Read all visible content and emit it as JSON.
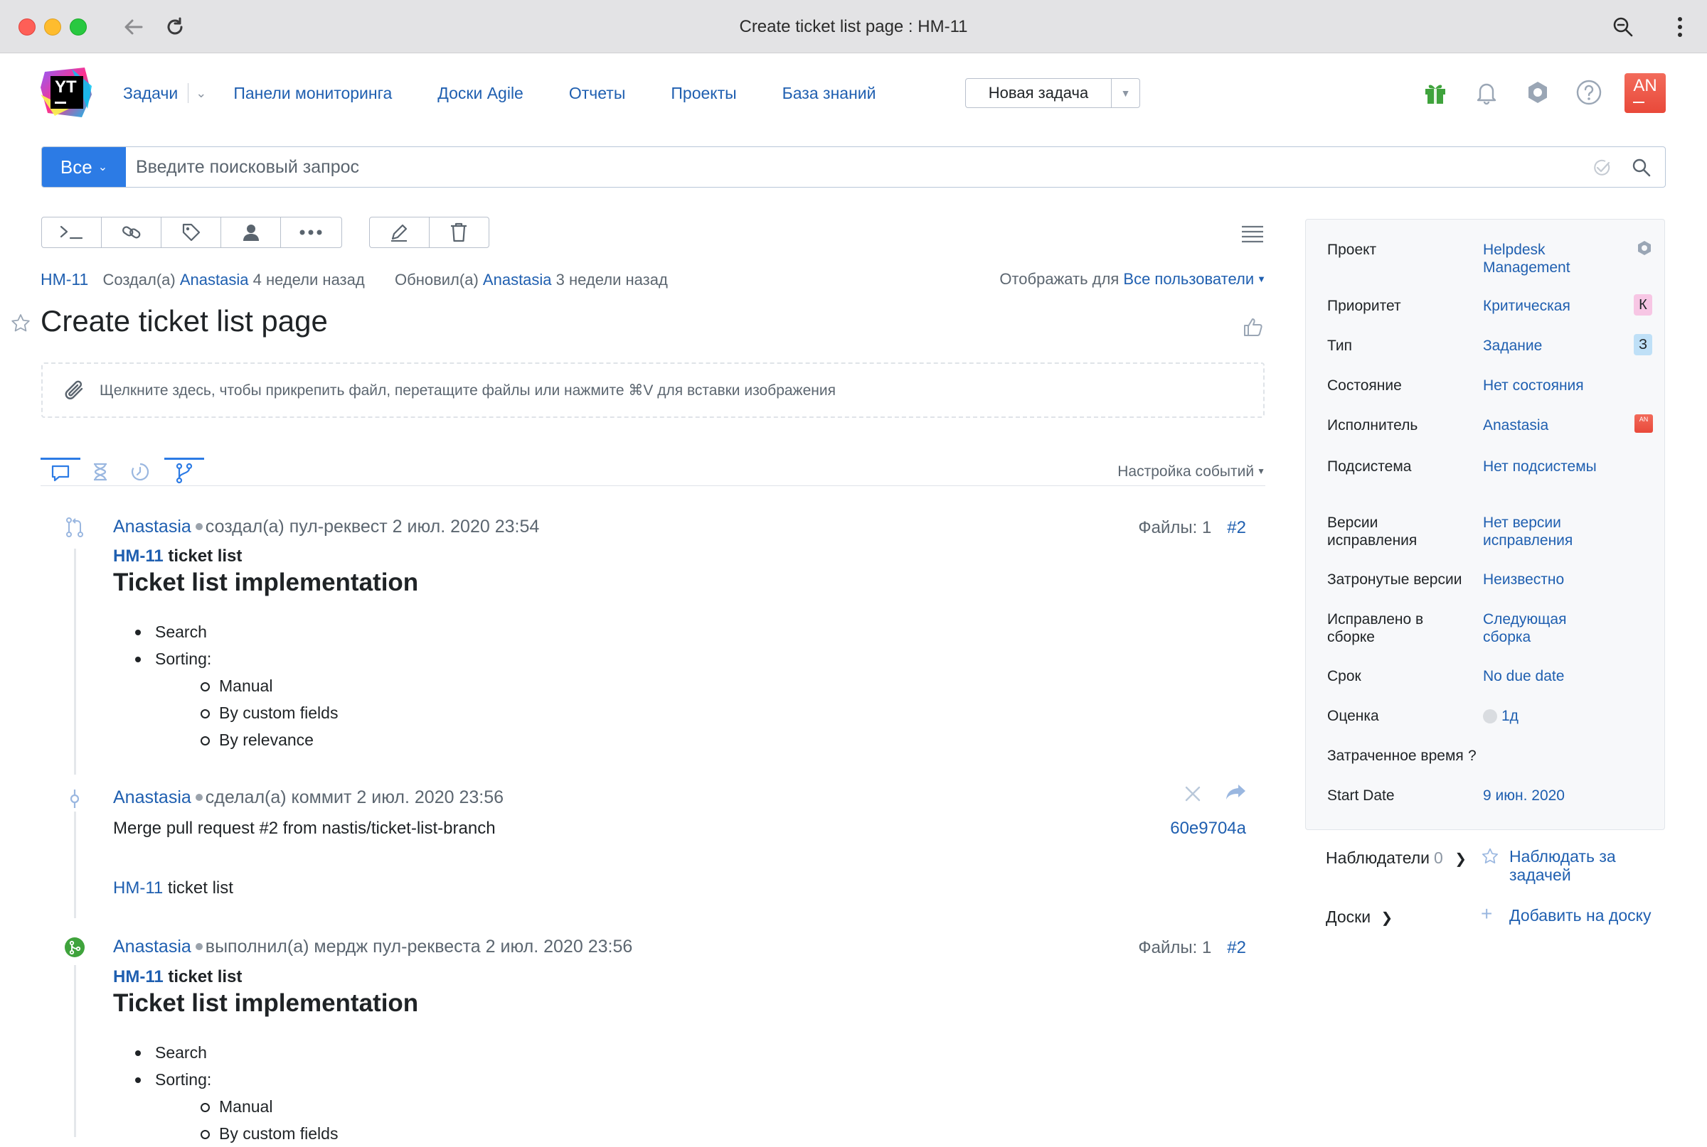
{
  "window": {
    "title": "Create ticket list page : HM-11"
  },
  "logo": {
    "text": "YT"
  },
  "nav": {
    "issues": "Задачи",
    "dashboards": "Панели мониторинга",
    "agile": "Доски Agile",
    "reports": "Отчеты",
    "projects": "Проекты",
    "kb": "База знаний",
    "new_issue": "Новая задача"
  },
  "user": {
    "initials": "AN"
  },
  "search": {
    "context": "Все",
    "placeholder": "Введите поисковый запрос"
  },
  "issue": {
    "id": "HM-11",
    "created_label": "Создал(а)",
    "created_by": "Anastasia",
    "created_ago": "4 недели назад",
    "updated_label": "Обновил(а)",
    "updated_by": "Anastasia",
    "updated_ago": "3 недели назад",
    "visible_label": "Отображать для",
    "visible_value": "Все пользователи",
    "summary": "Create ticket list page",
    "attach_hint": "Щелкните здесь, чтобы прикрепить файл, перетащите файлы или нажмите ⌘V для вставки изображения"
  },
  "activity": {
    "events_settings": "Настройка событий"
  },
  "feed": [
    {
      "author": "Anastasia",
      "action": "создал(а) пул-реквест 2 июл. 2020 23:54",
      "files": "Файлы: 1",
      "hash": "#2",
      "title_id": "HM-11",
      "title_text": "ticket list",
      "heading": "Ticket list implementation",
      "bullets": [
        "Search",
        "Sorting:",
        "Manual",
        "By custom fields",
        "By relevance"
      ]
    },
    {
      "author": "Anastasia",
      "action": "сделал(а) коммит 2 июл. 2020 23:56",
      "message": "Merge pull request #2 from nastis/ticket-list-branch",
      "commit": "60e9704a",
      "ref_id": "HM-11",
      "ref_text": "ticket list"
    },
    {
      "author": "Anastasia",
      "action": "выполнил(а) мердж пул-реквеста 2 июл. 2020 23:56",
      "files": "Файлы: 1",
      "hash": "#2",
      "title_id": "HM-11",
      "title_text": "ticket list",
      "heading": "Ticket list implementation",
      "bullets": [
        "Search",
        "Sorting:",
        "Manual",
        "By custom fields"
      ]
    }
  ],
  "fields": [
    {
      "key": "Проект",
      "value": "Helpdesk Management"
    },
    {
      "key": "Приоритет",
      "value": "Критическая",
      "badge": "К",
      "badge_color": "#f7c6e4"
    },
    {
      "key": "Тип",
      "value": "Задание",
      "badge": "З",
      "badge_color": "#bfe0f7"
    },
    {
      "key": "Состояние",
      "value": "Нет состояния"
    },
    {
      "key": "Исполнитель",
      "value": "Anastasia",
      "avatar": "AN"
    },
    {
      "key": "Подсистема",
      "value": "Нет подсистемы"
    },
    {
      "key": "Версии исправления",
      "value": "Нет версии исправления"
    },
    {
      "key": "Затронутые версии",
      "value": "Неизвестно"
    },
    {
      "key": "Исправлено в сборке",
      "value": "Следующая сборка"
    },
    {
      "key": "Срок",
      "value": "No due date"
    },
    {
      "key": "Оценка",
      "value": "1д"
    },
    {
      "key": "Затраченное время",
      "value": "?"
    },
    {
      "key": "Start Date",
      "value": "9 июн. 2020"
    }
  ],
  "watchers": {
    "label": "Наблюдатели",
    "count": "0",
    "action": "Наблюдать за задачей"
  },
  "boards": {
    "label": "Доски",
    "action": "Добавить на доску"
  }
}
